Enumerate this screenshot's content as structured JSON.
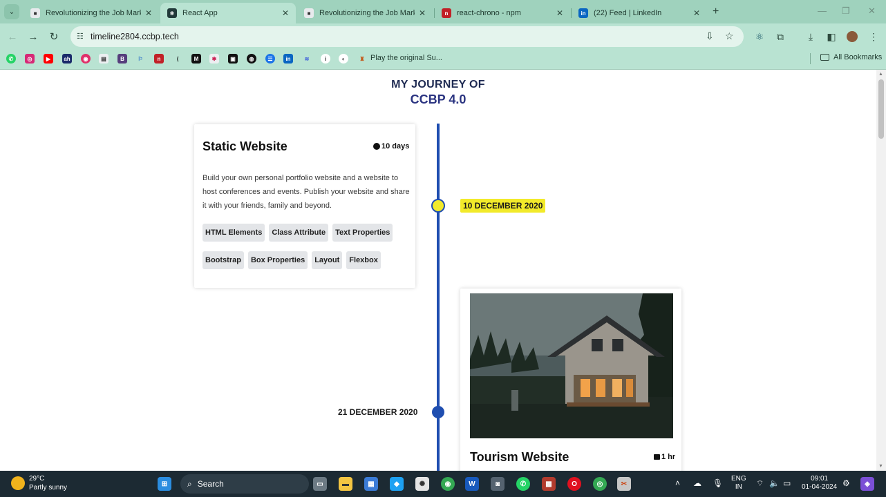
{
  "browser": {
    "tabs": [
      {
        "title": "Revolutionizing the Job Market",
        "favicon_color": "#e8eaed",
        "active": false
      },
      {
        "title": "React App",
        "favicon_color": "#223a3a",
        "active": true
      },
      {
        "title": "Revolutionizing the Job Market",
        "favicon_color": "#e8eaed",
        "active": false
      },
      {
        "title": "react-chrono - npm",
        "favicon_color": "#c12127",
        "active": false
      },
      {
        "title": "(22) Feed | LinkedIn",
        "favicon_color": "#0a66c2",
        "active": false
      }
    ],
    "new_tab_label": "+",
    "url": "timeline2804.ccbp.tech",
    "bookmarks_label": "Play the original Su...",
    "all_bookmarks_label": "All Bookmarks"
  },
  "page": {
    "heading_line1": "MY JOURNEY OF",
    "heading_line2": "CCBP 4.0",
    "timeline": {
      "line_color": "#1f4eb0",
      "items": [
        {
          "date": "10 DECEMBER 2020",
          "date_highlight": "#f2ea2a",
          "title": "Static Website",
          "duration": "10 days",
          "description": "Build your own personal portfolio website and a website to host conferences and events. Publish your website and share it with your friends, family and beyond.",
          "tags": [
            "HTML Elements",
            "Class Attribute",
            "Text Properties",
            "Bootstrap",
            "Box Properties",
            "Layout",
            "Flexbox"
          ]
        },
        {
          "date": "21 DECEMBER 2020",
          "title": "Tourism Website",
          "duration": "1 hr"
        }
      ]
    }
  },
  "taskbar": {
    "temperature": "29°C",
    "condition": "Partly sunny",
    "search_label": "Search",
    "language": "ENG",
    "region": "IN",
    "time": "09:01",
    "date": "01-04-2024"
  }
}
